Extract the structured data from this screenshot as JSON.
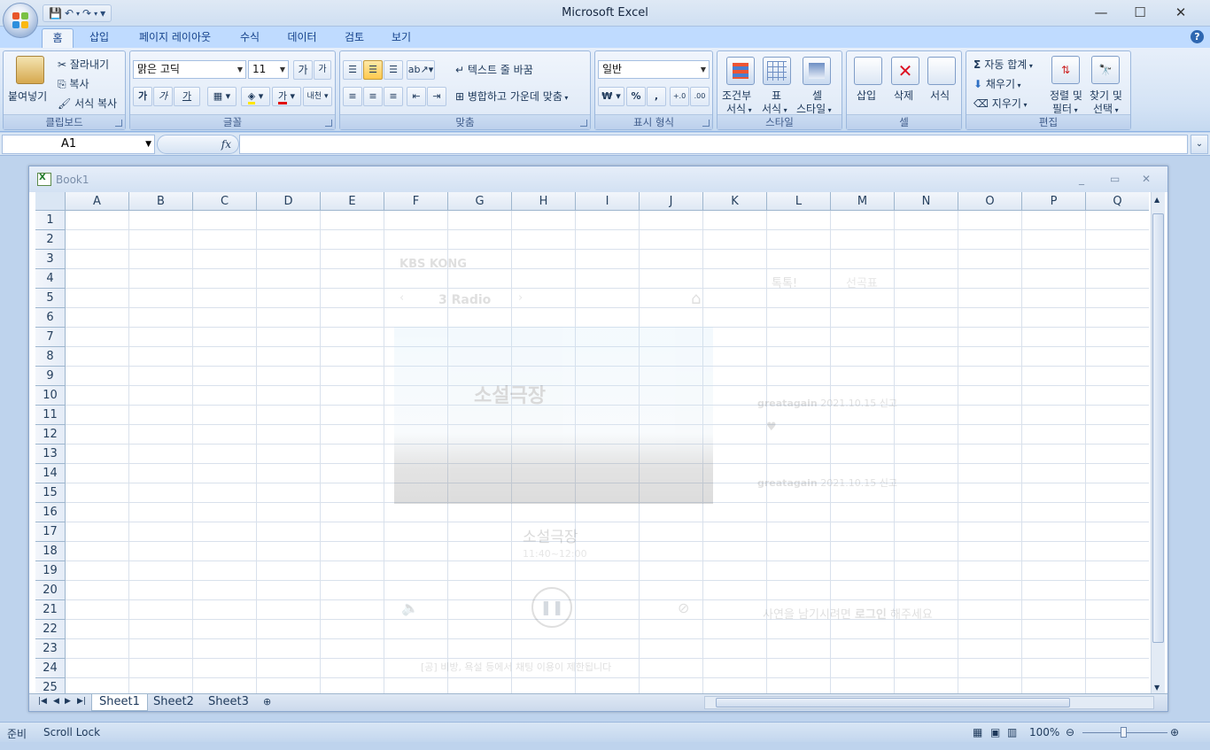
{
  "app": {
    "title": "Microsoft Excel"
  },
  "qat": {
    "save": "💾",
    "undo": "↶",
    "redo": "↷",
    "customize": "▾"
  },
  "window": {
    "minimize": "—",
    "maximize": "☐",
    "close": "✕"
  },
  "tabs": [
    {
      "label": "홈",
      "active": true
    },
    {
      "label": "삽입"
    },
    {
      "label": "페이지 레이아웃"
    },
    {
      "label": "수식"
    },
    {
      "label": "데이터"
    },
    {
      "label": "검토"
    },
    {
      "label": "보기"
    }
  ],
  "ribbon": {
    "clipboard": {
      "label": "클립보드",
      "paste": "붙여넣기",
      "cut": "잘라내기",
      "copy": "복사",
      "format_painter": "서식 복사"
    },
    "font": {
      "label": "글꼴",
      "font_name": "맑은 고딕",
      "font_size": "11",
      "grow": "가",
      "shrink": "가",
      "bold": "가",
      "italic": "가",
      "underline": "가",
      "phonetic": "내천"
    },
    "alignment": {
      "label": "맞춤",
      "wrap_text": "텍스트 줄 바꿈",
      "merge_center": "병합하고 가운데 맞춤"
    },
    "number": {
      "label": "표시 형식",
      "format": "일반",
      "currency": "₩",
      "percent": "%",
      "comma": ","
    },
    "styles": {
      "label": "스타일",
      "conditional": [
        "조건부",
        "서식"
      ],
      "table": [
        "표",
        "서식"
      ],
      "cell": [
        "셀",
        "스타일"
      ]
    },
    "cells": {
      "label": "셀",
      "insert": "삽입",
      "delete": "삭제",
      "format": "서식"
    },
    "editing": {
      "label": "편집",
      "autosum": "자동 합계",
      "fill": "채우기",
      "clear": "지우기",
      "sort": [
        "정렬 및",
        "필터"
      ],
      "find": [
        "찾기 및",
        "선택"
      ]
    }
  },
  "formula_bar": {
    "name_box": "A1",
    "fx": "fx",
    "value": ""
  },
  "workbook": {
    "title": "Book1",
    "minimize": "_",
    "restore": "▭",
    "close": "✕"
  },
  "columns": [
    "A",
    "B",
    "C",
    "D",
    "E",
    "F",
    "G",
    "H",
    "I",
    "J",
    "K",
    "L",
    "M",
    "N",
    "O",
    "P",
    "Q"
  ],
  "rows": [
    "1",
    "2",
    "3",
    "4",
    "5",
    "6",
    "7",
    "8",
    "9",
    "10",
    "11",
    "12",
    "13",
    "14",
    "15",
    "16",
    "17",
    "18",
    "19",
    "20",
    "21",
    "22",
    "23",
    "24",
    "25"
  ],
  "sheets": [
    {
      "label": "Sheet1",
      "active": true
    },
    {
      "label": "Sheet2"
    },
    {
      "label": "Sheet3"
    }
  ],
  "background_overlay": {
    "station": "KBS KONG",
    "channel": "3 Radio",
    "program_art_text": "소설극장",
    "program": "소설극장",
    "time": "11:40~12:00",
    "tab_1": "톡톡!",
    "tab_2": "선곡표",
    "user_1": "greatagain",
    "date_1": "2021.10.15",
    "tag_1": "신고",
    "user_2": "greatagain",
    "date_2": "2021.10.15",
    "tag_2": "신고",
    "login_prompt_1": "사연을 남기시려면",
    "login_prompt_link": "로그인",
    "login_prompt_2": "해주세요",
    "notice": "[공] 비방, 욕설 등에서 채팅 이용이 제한됩니다"
  },
  "status": {
    "ready": "준비",
    "scroll_lock": "Scroll Lock",
    "zoom": "100%"
  },
  "colors": {
    "accent": "#15428b",
    "ribbon": "#dbe7f5"
  }
}
